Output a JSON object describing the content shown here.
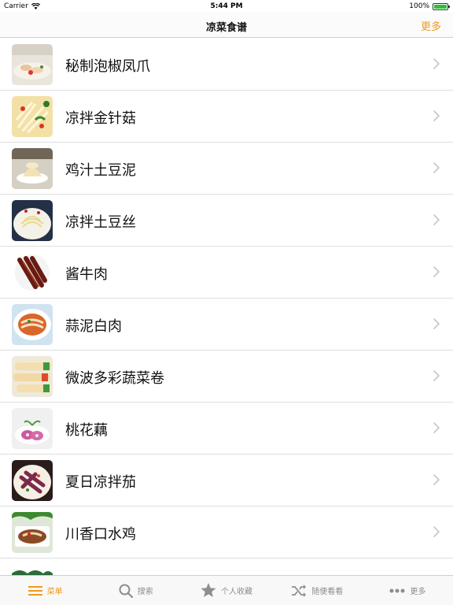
{
  "status_bar": {
    "carrier": "Carrier",
    "time": "5:44 PM",
    "battery": "100%",
    "battery_level": 1.0
  },
  "nav": {
    "title": "凉菜食谱",
    "more": "更多"
  },
  "recipes": [
    {
      "name": "秘制泡椒凤爪",
      "thumb": "thumb-1"
    },
    {
      "name": "凉拌金针菇",
      "thumb": "thumb-2"
    },
    {
      "name": "鸡汁土豆泥",
      "thumb": "thumb-3"
    },
    {
      "name": "凉拌土豆丝",
      "thumb": "thumb-4"
    },
    {
      "name": "酱牛肉",
      "thumb": "thumb-5"
    },
    {
      "name": "蒜泥白肉",
      "thumb": "thumb-6"
    },
    {
      "name": "微波多彩蔬菜卷",
      "thumb": "thumb-7"
    },
    {
      "name": "桃花藕",
      "thumb": "thumb-8"
    },
    {
      "name": "夏日凉拌茄",
      "thumb": "thumb-9"
    },
    {
      "name": "川香口水鸡",
      "thumb": "thumb-10"
    },
    {
      "name": "",
      "thumb": "thumb-11"
    }
  ],
  "tabs": [
    {
      "label": "菜单",
      "icon": "menu-icon",
      "active": true
    },
    {
      "label": "搜索",
      "icon": "search-icon",
      "active": false
    },
    {
      "label": "个人收藏",
      "icon": "star-icon",
      "active": false
    },
    {
      "label": "随便看看",
      "icon": "shuffle-icon",
      "active": false
    },
    {
      "label": "更多",
      "icon": "more-dots-icon",
      "active": false
    }
  ],
  "colors": {
    "accent": "#f09a1e",
    "inactive": "#8e8e8e",
    "divider": "#dedede"
  }
}
